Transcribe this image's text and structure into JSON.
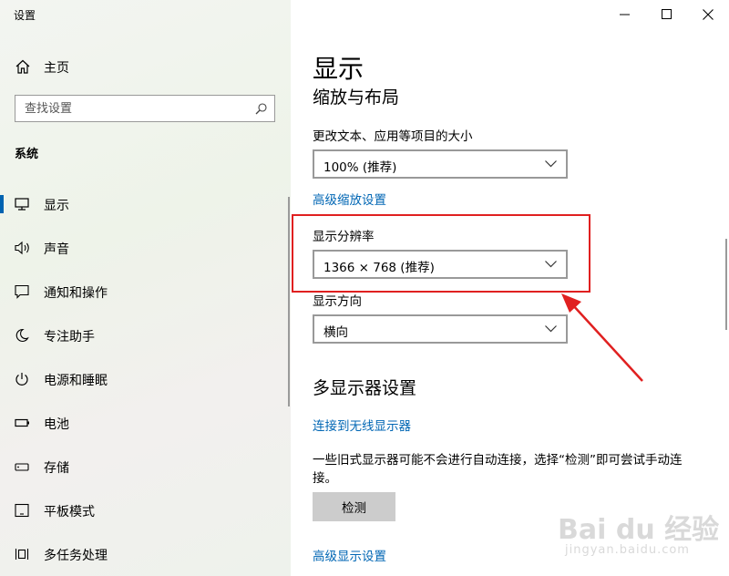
{
  "app_title": "设置",
  "sidebar": {
    "home_label": "主页",
    "search_placeholder": "查找设置",
    "section_title": "系统",
    "items": [
      {
        "label": "显示",
        "icon": "monitor-icon",
        "active": true
      },
      {
        "label": "声音",
        "icon": "speaker-icon"
      },
      {
        "label": "通知和操作",
        "icon": "notification-icon"
      },
      {
        "label": "专注助手",
        "icon": "moon-icon"
      },
      {
        "label": "电源和睡眠",
        "icon": "power-icon"
      },
      {
        "label": "电池",
        "icon": "battery-icon"
      },
      {
        "label": "存储",
        "icon": "storage-icon"
      },
      {
        "label": "平板模式",
        "icon": "tablet-icon"
      },
      {
        "label": "多任务处理",
        "icon": "multitasking-icon"
      }
    ]
  },
  "window_controls": [
    "minimize-icon",
    "maximize-icon",
    "close-icon"
  ],
  "main": {
    "page_title": "显示",
    "scale_heading": "缩放与布局",
    "scale_label": "更改文本、应用等项目的大小",
    "scale_value": "100% (推荐)",
    "advanced_scaling_link": "高级缩放设置",
    "resolution_label": "显示分辨率",
    "resolution_value": "1366 × 768 (推荐)",
    "orientation_label": "显示方向",
    "orientation_value": "横向",
    "multi_heading": "多显示器设置",
    "wireless_link": "连接到无线显示器",
    "multi_desc": "一些旧式显示器可能不会进行自动连接，选择“检测”即可尝试手动连接。",
    "detect_button": "检测",
    "advanced_display_link": "高级显示设置"
  },
  "colors": {
    "accent": "#0063b1",
    "link": "#0066b4",
    "annotation": "#e02020"
  },
  "watermark": {
    "text": "Bai du 经验",
    "sub": "jingyan.baidu.com"
  }
}
